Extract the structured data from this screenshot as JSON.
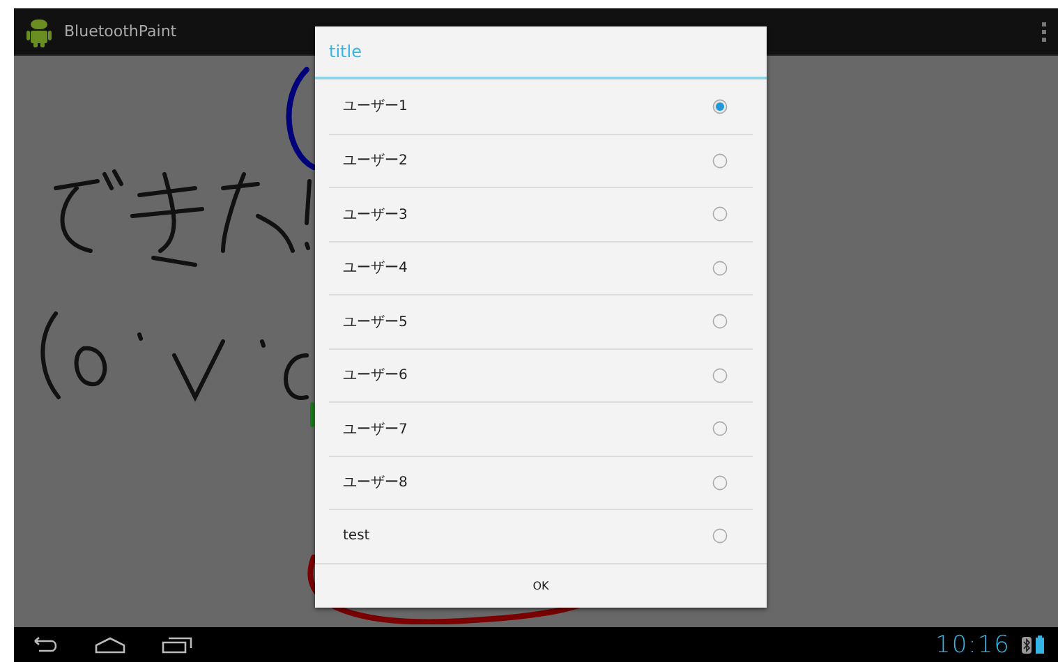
{
  "action_bar": {
    "app_title": "BluetoothPaint"
  },
  "dialog": {
    "title": "title",
    "options": [
      {
        "label": "ユーザー1",
        "selected": true
      },
      {
        "label": "ユーザー2",
        "selected": false
      },
      {
        "label": "ユーザー3",
        "selected": false
      },
      {
        "label": "ユーザー4",
        "selected": false
      },
      {
        "label": "ユーザー5",
        "selected": false
      },
      {
        "label": "ユーザー6",
        "selected": false
      },
      {
        "label": "ユーザー7",
        "selected": false
      },
      {
        "label": "ユーザー8",
        "selected": false
      },
      {
        "label": "test",
        "selected": false
      }
    ],
    "button": "OK"
  },
  "system_bar": {
    "time": "10:16"
  }
}
